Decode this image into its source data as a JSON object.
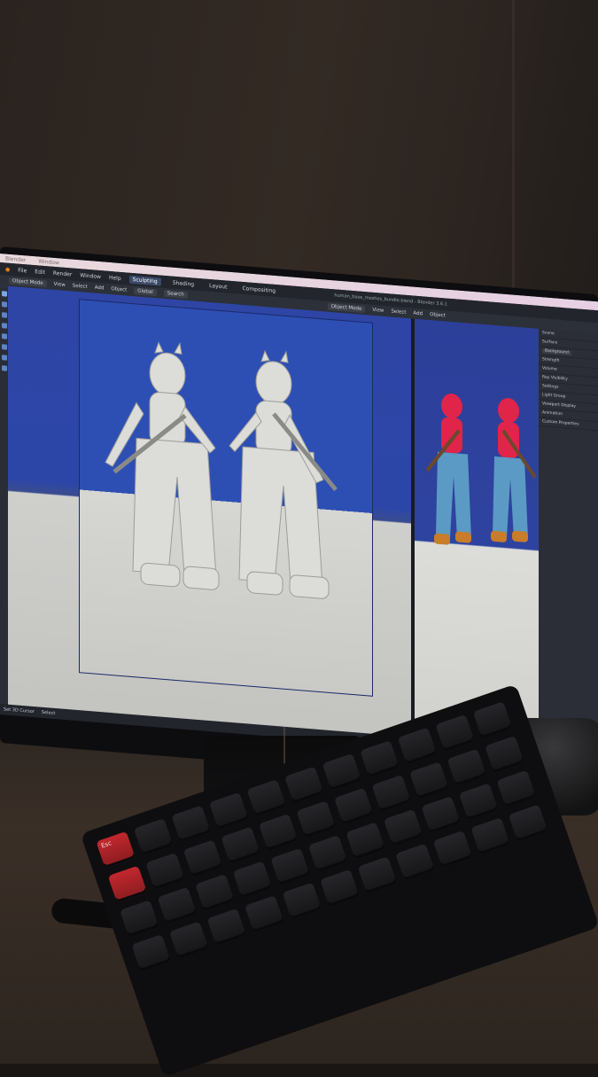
{
  "os_menu": [
    "Blender",
    "Window"
  ],
  "blender": {
    "menus": [
      "File",
      "Edit",
      "Render",
      "Window",
      "Help"
    ],
    "workspace_tabs": [
      "Sculpting",
      "Shading",
      "Layout",
      "Compositing"
    ],
    "active_tab": "Sculpting",
    "window_title": "human_base_meshes_bundle.blend - Blender 3.6.1",
    "header": {
      "mode": "Object Mode",
      "view": "View",
      "select": "Select",
      "add": "Add",
      "object": "Object",
      "orientation": "Global",
      "search": "Search"
    },
    "render_header": {
      "mode": "Object Mode",
      "view": "View",
      "select": "Select",
      "add": "Add",
      "object": "Object"
    },
    "properties": [
      "Scene",
      "Surface",
      "Background",
      "Strength",
      "Volume",
      "Ray Visibility",
      "Settings",
      "Light Group",
      "Viewport Display",
      "Animation",
      "Custom Properties"
    ],
    "status": {
      "left": "Set 3D Cursor",
      "right": "Select"
    }
  },
  "colors": {
    "viewport_sky": "#2e45a5",
    "floor": "#c9c9c6",
    "clay": "#d9d9d6",
    "skin_red": "#e0244a",
    "jeans_blue": "#5b9ac4",
    "boots": "#c97c2a"
  },
  "keyboard": {
    "esc_label": "Esc"
  }
}
